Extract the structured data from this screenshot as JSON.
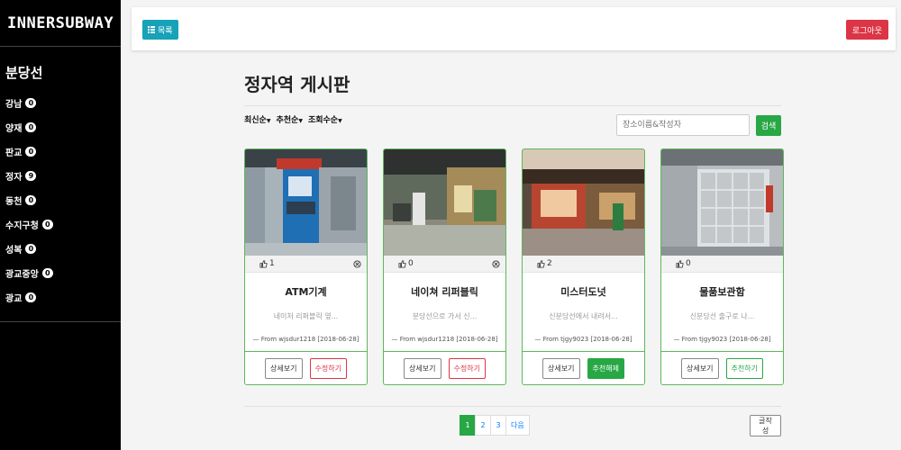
{
  "brand": "INNERSUBWAY",
  "sidebar": {
    "title": "분당선",
    "items": [
      {
        "label": "강남",
        "count": "0"
      },
      {
        "label": "양재",
        "count": "0"
      },
      {
        "label": "판교",
        "count": "0"
      },
      {
        "label": "정자",
        "count": "9"
      },
      {
        "label": "동천",
        "count": "0"
      },
      {
        "label": "수지구청",
        "count": "0"
      },
      {
        "label": "성복",
        "count": "0"
      },
      {
        "label": "광교중앙",
        "count": "0"
      },
      {
        "label": "광교",
        "count": "0"
      }
    ]
  },
  "topbar": {
    "list_label": "목록",
    "logout_label": "로그아웃"
  },
  "board": {
    "title": "정자역 게시판",
    "sort": [
      "최신순",
      "추천순",
      "조회수순"
    ],
    "search_placeholder": "장소이름&작성자",
    "search_label": "검색"
  },
  "cards": [
    {
      "likes": "1",
      "title": "ATM기계",
      "desc": "네이처 리퍼블릭 옆...",
      "from": "— From wjsdur1218 [2018-06-28]",
      "detail": "상세보기",
      "action": "수정하기",
      "action_type": "edit",
      "close": true
    },
    {
      "likes": "0",
      "title": "네이쳐 리퍼블릭",
      "desc": "분당선으로 가서 신...",
      "from": "— From wjsdur1218 [2018-06-28]",
      "detail": "상세보기",
      "action": "수정하기",
      "action_type": "edit",
      "close": true
    },
    {
      "likes": "2",
      "title": "미스터도넛",
      "desc": "신분당선에서 내려서...",
      "from": "— From tjgy9023 [2018-06-28]",
      "detail": "상세보기",
      "action": "추천해제",
      "action_type": "unrecommend",
      "close": false
    },
    {
      "likes": "0",
      "title": "물품보관함",
      "desc": "신분당선 출구로 나...",
      "from": "— From tjgy9023 [2018-06-28]",
      "detail": "상세보기",
      "action": "추천하기",
      "action_type": "recommend",
      "close": false
    }
  ],
  "pagination": {
    "pages": [
      "1",
      "2",
      "3"
    ],
    "next": "다음",
    "active": "1"
  },
  "write_label": "글작성",
  "colors": {
    "primary_green": "#28a745",
    "info": "#17a2b8",
    "danger": "#dc3545",
    "sidebar": "#000000"
  }
}
